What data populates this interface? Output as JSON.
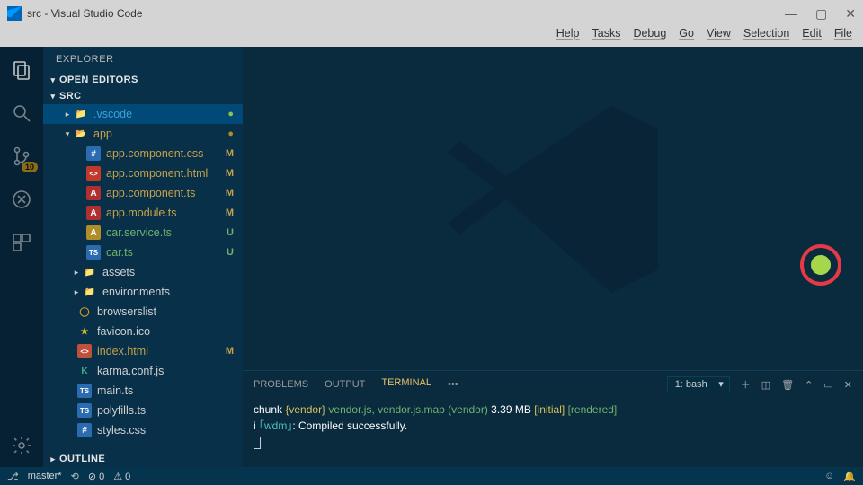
{
  "window": {
    "title": "src - Visual Studio Code"
  },
  "menubar": [
    "Help",
    "Tasks",
    "Debug",
    "Go",
    "View",
    "Selection",
    "Edit",
    "File"
  ],
  "activitybar": {
    "scm_badge": "10"
  },
  "sidebar": {
    "title": "EXPLORER",
    "sections": {
      "openEditors": "OPEN EDITORS",
      "folder": "SRC",
      "outline": "OUTLINE"
    },
    "tree": {
      "vscode": {
        "label": ".vscode",
        "status": "●"
      },
      "app": {
        "label": "app",
        "status": "●"
      },
      "appFiles": [
        {
          "name": "app.component.css",
          "git": "M",
          "color": "#c7a24a",
          "icon": "#",
          "ibg": "#2b6cb0"
        },
        {
          "name": "app.component.html",
          "git": "M",
          "color": "#c7a24a",
          "icon": "<>",
          "ibg": "#c0392b"
        },
        {
          "name": "app.component.ts",
          "git": "M",
          "color": "#c7a24a",
          "icon": "A",
          "ibg": "#b03030"
        },
        {
          "name": "app.module.ts",
          "git": "M",
          "color": "#c7a24a",
          "icon": "A",
          "ibg": "#b03030"
        },
        {
          "name": "car.service.ts",
          "git": "U",
          "color": "#6fb36f",
          "icon": "A",
          "ibg": "#b08d2a"
        },
        {
          "name": "car.ts",
          "git": "U",
          "color": "#6fb36f",
          "icon": "TS",
          "ibg": "#2b6cb0"
        }
      ],
      "folders2": [
        {
          "name": "assets"
        },
        {
          "name": "environments"
        }
      ],
      "rootFiles": [
        {
          "name": "browserslist",
          "icon": "◯",
          "ic": "#d89b2a"
        },
        {
          "name": "favicon.ico",
          "icon": "★",
          "ic": "#d8b82a"
        },
        {
          "name": "index.html",
          "icon": "<>",
          "ic": "#c0503b",
          "git": "M",
          "color": "#c7a24a"
        },
        {
          "name": "karma.conf.js",
          "icon": "K",
          "ic": "#3fae8f"
        },
        {
          "name": "main.ts",
          "icon": "TS",
          "ic": "#2b6cb0"
        },
        {
          "name": "polyfills.ts",
          "icon": "TS",
          "ic": "#2b6cb0"
        },
        {
          "name": "styles.css",
          "icon": "#",
          "ic": "#2b6cb0"
        }
      ]
    }
  },
  "panel": {
    "tabs": {
      "problems": "PROBLEMS",
      "output": "OUTPUT",
      "terminal": "TERMINAL"
    },
    "dots": "•••",
    "terminalSelector": "1: bash",
    "terminalOutput": {
      "l1a": "chunk ",
      "l1b": "{vendor}",
      "l1c": " vendor.js, vendor.js.map ",
      "l1d": "(vendor)",
      "l1e": " 3.39 MB ",
      "l1f": "[initial]",
      "l1g": "  ",
      "l1h": "[rendered]",
      "l2a": "i ",
      "l2b": "｢wdm｣",
      "l2c": ": Compiled successfully."
    }
  },
  "statusbar": {
    "branch": "master*",
    "sync": "⟳",
    "errors": "⊘ 0",
    "warnings": "⚠ 0"
  }
}
